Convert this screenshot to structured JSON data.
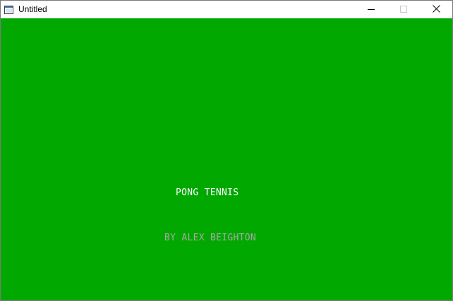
{
  "window": {
    "title": "Untitled",
    "icons": {
      "app": "app-window-icon",
      "minimize": "minimize-icon",
      "maximize": "maximize-icon",
      "close": "close-icon"
    }
  },
  "game": {
    "background_color": "#00a800",
    "title": "PONG TENNIS",
    "title_color": "#ffffff",
    "credit": "BY ALEX BEIGHTON",
    "credit_color": "#a8a8a8"
  }
}
